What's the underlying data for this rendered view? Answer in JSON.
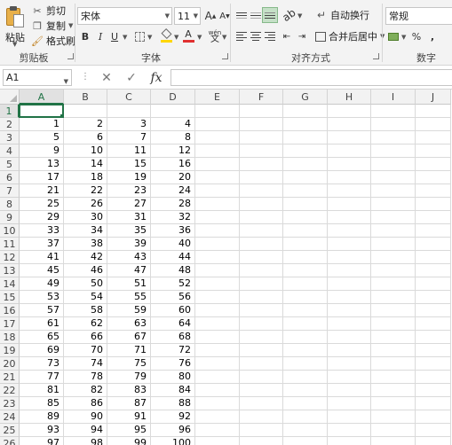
{
  "ribbon": {
    "clipboard": {
      "paste_label": "粘贴",
      "cut_label": "剪切",
      "copy_label": "复制",
      "format_painter_label": "格式刷",
      "group_label": "剪贴板"
    },
    "font": {
      "font_name": "宋体",
      "font_size": "11",
      "group_label": "字体",
      "bold": "B",
      "italic": "I",
      "underline": "U",
      "grow": "A",
      "shrink": "A",
      "wen": "wén"
    },
    "alignment": {
      "wrap_text_label": "自动换行",
      "merge_center_label": "合并后居中",
      "group_label": "对齐方式"
    },
    "number": {
      "format": "常规",
      "percent": "%",
      "comma": ",",
      "group_label": "数字"
    }
  },
  "formula_bar": {
    "name_box": "A1",
    "separator": "⋮",
    "cancel": "✕",
    "enter": "✓",
    "fx": "fx",
    "formula": ""
  },
  "sheet": {
    "columns": [
      "A",
      "B",
      "C",
      "D",
      "E",
      "F",
      "G",
      "H",
      "I",
      "J"
    ],
    "row_numbers": [
      "1",
      "2",
      "3",
      "4",
      "5",
      "6",
      "7",
      "8",
      "9",
      "10",
      "11",
      "12",
      "13",
      "14",
      "15",
      "16",
      "17",
      "18",
      "19",
      "20",
      "21",
      "22",
      "23",
      "24",
      "25",
      "26"
    ],
    "rows": [
      [
        "",
        "",
        "",
        ""
      ],
      [
        "1",
        "2",
        "3",
        "4"
      ],
      [
        "5",
        "6",
        "7",
        "8"
      ],
      [
        "9",
        "10",
        "11",
        "12"
      ],
      [
        "13",
        "14",
        "15",
        "16"
      ],
      [
        "17",
        "18",
        "19",
        "20"
      ],
      [
        "21",
        "22",
        "23",
        "24"
      ],
      [
        "25",
        "26",
        "27",
        "28"
      ],
      [
        "29",
        "30",
        "31",
        "32"
      ],
      [
        "33",
        "34",
        "35",
        "36"
      ],
      [
        "37",
        "38",
        "39",
        "40"
      ],
      [
        "41",
        "42",
        "43",
        "44"
      ],
      [
        "45",
        "46",
        "47",
        "48"
      ],
      [
        "49",
        "50",
        "51",
        "52"
      ],
      [
        "53",
        "54",
        "55",
        "56"
      ],
      [
        "57",
        "58",
        "59",
        "60"
      ],
      [
        "61",
        "62",
        "63",
        "64"
      ],
      [
        "65",
        "66",
        "67",
        "68"
      ],
      [
        "69",
        "70",
        "71",
        "72"
      ],
      [
        "73",
        "74",
        "75",
        "76"
      ],
      [
        "77",
        "78",
        "79",
        "80"
      ],
      [
        "81",
        "82",
        "83",
        "84"
      ],
      [
        "85",
        "86",
        "87",
        "88"
      ],
      [
        "89",
        "90",
        "91",
        "92"
      ],
      [
        "93",
        "94",
        "95",
        "96"
      ],
      [
        "97",
        "98",
        "99",
        "100"
      ]
    ],
    "active_cell": "A1"
  },
  "colors": {
    "accent": "#217346",
    "font_color": "#e03030",
    "highlight": "#ffd700"
  }
}
